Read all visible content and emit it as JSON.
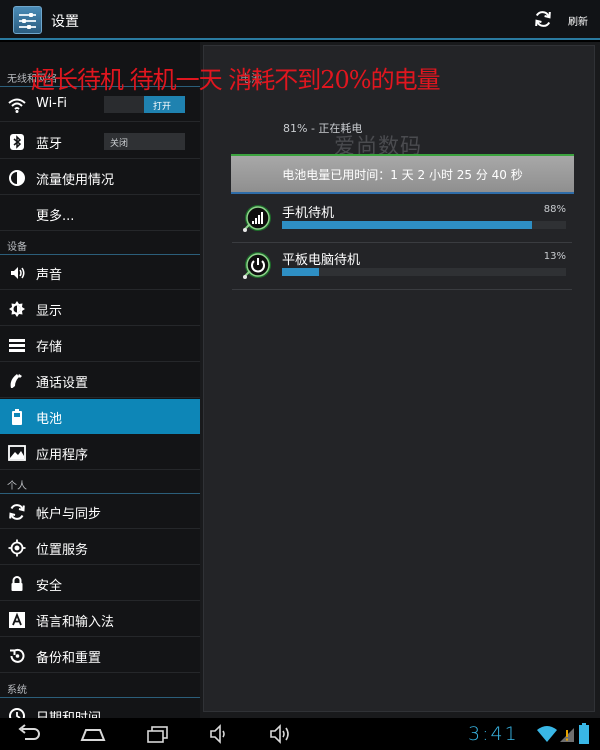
{
  "actionbar": {
    "title": "设置",
    "refresh_label": "刷新"
  },
  "sidebar": {
    "sections": [
      "无线和网络",
      "设备",
      "个人",
      "系统"
    ],
    "items": [
      {
        "label": "Wi-Fi",
        "icon": "wifi-icon",
        "toggle": "打开"
      },
      {
        "label": "蓝牙",
        "icon": "bluetooth-icon",
        "toggle": "关闭"
      },
      {
        "label": "流量使用情况",
        "icon": "data-usage-icon"
      },
      {
        "label": "更多...",
        "icon": ""
      },
      {
        "label": "声音",
        "icon": "speaker-icon"
      },
      {
        "label": "显示",
        "icon": "brightness-icon"
      },
      {
        "label": "存储",
        "icon": "storage-icon"
      },
      {
        "label": "通话设置",
        "icon": "phone-icon"
      },
      {
        "label": "电池",
        "icon": "battery-icon",
        "selected": true
      },
      {
        "label": "应用程序",
        "icon": "apps-icon"
      },
      {
        "label": "帐户与同步",
        "icon": "sync-icon"
      },
      {
        "label": "位置服务",
        "icon": "location-icon"
      },
      {
        "label": "安全",
        "icon": "lock-icon"
      },
      {
        "label": "语言和输入法",
        "icon": "keyboard-icon"
      },
      {
        "label": "备份和重置",
        "icon": "backup-icon"
      },
      {
        "label": "日期和时间",
        "icon": "clock-icon"
      }
    ]
  },
  "battery": {
    "header": "电池",
    "level_text": "81% - 正在耗电",
    "usage_time": "电池电量已用时间：1 天 2 小时 25 分 40 秒",
    "overlay_text": "超长待机 待机一天 消耗不到20%的电量",
    "watermark": "爱尚数码",
    "entries": [
      {
        "name": "手机待机",
        "percent_label": "88%",
        "percent": 88,
        "icon": "signal-standby-icon"
      },
      {
        "name": "平板电脑待机",
        "percent_label": "13%",
        "percent": 13,
        "icon": "power-standby-icon"
      }
    ]
  },
  "status": {
    "time": "3:41"
  },
  "colors": {
    "accent": "#0d86b7",
    "bar_fill": "#2e8fc4",
    "overlay_red": "#e0161f",
    "clock_blue": "#39b7e6"
  }
}
